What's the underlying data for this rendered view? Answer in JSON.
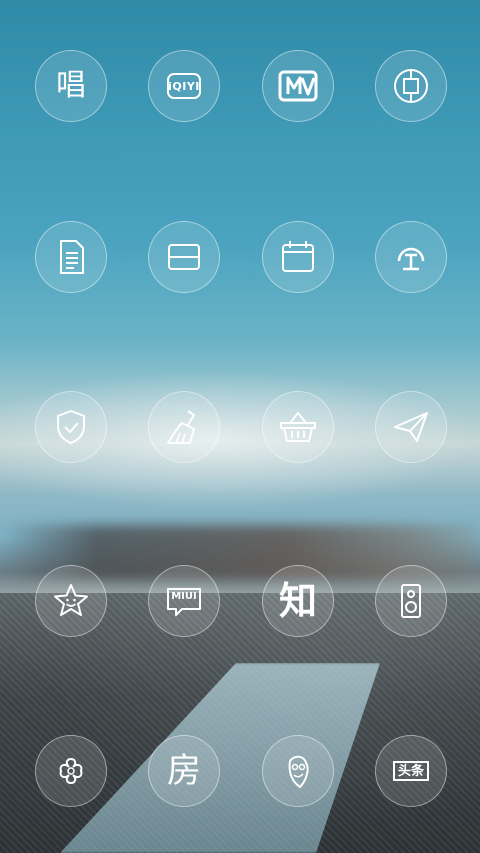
{
  "screen": {
    "icons": [
      {
        "name": "sing-app-icon",
        "glyph": "唱"
      },
      {
        "name": "iqiyi-app-icon",
        "glyph": "iQIYI"
      },
      {
        "name": "mgtv-app-icon",
        "glyph": ""
      },
      {
        "name": "bank-app-icon",
        "glyph": ""
      },
      {
        "name": "document-app-icon",
        "glyph": ""
      },
      {
        "name": "scanner-app-icon",
        "glyph": ""
      },
      {
        "name": "calendar-app-icon",
        "glyph": ""
      },
      {
        "name": "railway-app-icon",
        "glyph": ""
      },
      {
        "name": "security-app-icon",
        "glyph": ""
      },
      {
        "name": "cleaner-app-icon",
        "glyph": ""
      },
      {
        "name": "basket-app-icon",
        "glyph": ""
      },
      {
        "name": "send-app-icon",
        "glyph": ""
      },
      {
        "name": "star-app-icon",
        "glyph": ""
      },
      {
        "name": "miui-app-icon",
        "glyph": "MIUI"
      },
      {
        "name": "zhihu-app-icon",
        "glyph": "知"
      },
      {
        "name": "speaker-app-icon",
        "glyph": ""
      },
      {
        "name": "china-unicom-app-icon",
        "glyph": ""
      },
      {
        "name": "fang-app-icon",
        "glyph": "房"
      },
      {
        "name": "mascot-app-icon",
        "glyph": ""
      },
      {
        "name": "toutiao-app-icon",
        "glyph": "头条"
      }
    ],
    "colors": {
      "icon_stroke": "#ffffff"
    }
  }
}
